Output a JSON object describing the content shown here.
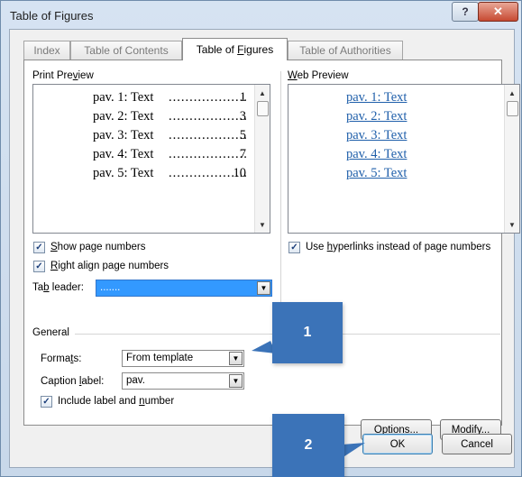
{
  "window": {
    "title": "Table of Figures",
    "help_glyph": "?",
    "close_glyph": "✕"
  },
  "tabs": [
    {
      "label": "Index"
    },
    {
      "label": "Table of Contents"
    },
    {
      "label": "Table of Figures"
    },
    {
      "label": "Table of Authorities"
    }
  ],
  "print_preview": {
    "label": "Print Preview",
    "entries": [
      {
        "text": "pav. 1: Text",
        "page": "1"
      },
      {
        "text": "pav. 2: Text",
        "page": "3"
      },
      {
        "text": "pav. 3: Text",
        "page": "5"
      },
      {
        "text": "pav. 4: Text",
        "page": "7"
      },
      {
        "text": "pav. 5: Text",
        "page": "10"
      }
    ],
    "dots": "....................................."
  },
  "web_preview": {
    "label": "Web Preview",
    "entries": [
      "pav. 1: Text",
      "pav. 2: Text",
      "pav. 3: Text",
      "pav. 4: Text",
      "pav. 5: Text"
    ]
  },
  "options": {
    "show_page_numbers": {
      "label": "Show page numbers",
      "checked": true
    },
    "right_align": {
      "label": "Right align page numbers",
      "checked": true
    },
    "use_hyperlinks": {
      "label": "Use hyperlinks instead of page numbers",
      "checked": true
    },
    "tab_leader": {
      "label": "Tab leader:",
      "value": "......."
    }
  },
  "general": {
    "label": "General",
    "formats": {
      "label": "Formats:",
      "value": "From template"
    },
    "caption_label": {
      "label": "Caption label:",
      "value": "pav."
    },
    "include_label": {
      "label": "Include label and number",
      "checked": true
    }
  },
  "buttons": {
    "options": "Options...",
    "modify": "Modify...",
    "ok": "OK",
    "cancel": "Cancel"
  },
  "callouts": {
    "one": "1",
    "two": "2"
  },
  "colors": {
    "accent": "#3b73b8",
    "selection": "#3399ff",
    "link": "#1f5faa"
  }
}
